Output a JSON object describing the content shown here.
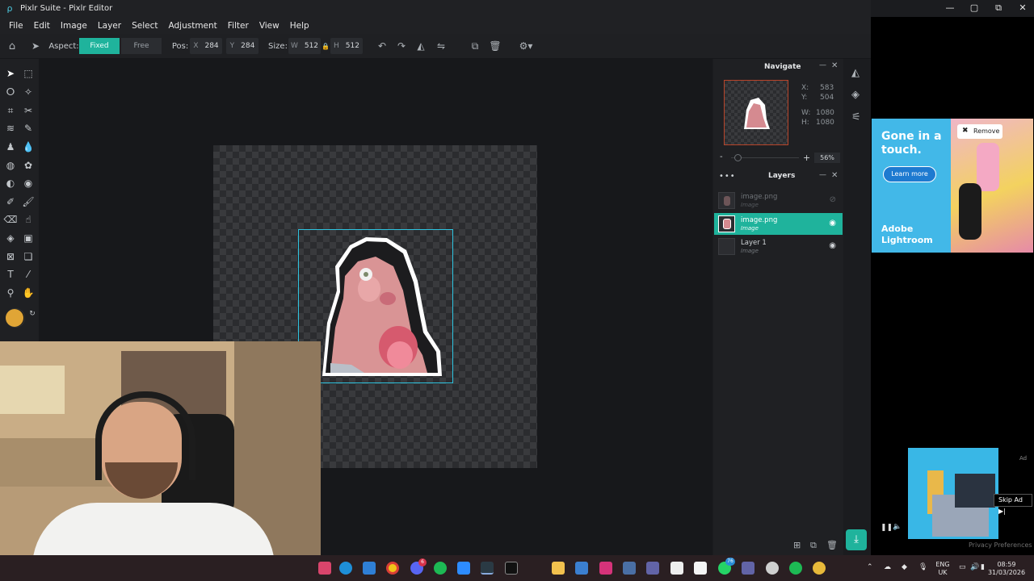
{
  "window": {
    "title": "Pixlr Suite - Pixlr Editor"
  },
  "menu": [
    "File",
    "Edit",
    "Image",
    "Layer",
    "Select",
    "Adjustment",
    "Filter",
    "View",
    "Help"
  ],
  "options": {
    "aspect_label": "Aspect:",
    "fixed": "Fixed",
    "free": "Free",
    "pos_label": "Pos:",
    "x_key": "X",
    "x_value": "284",
    "y_key": "Y",
    "y_value": "284",
    "size_label": "Size:",
    "w_key": "W",
    "w_value": "512",
    "h_key": "H",
    "h_value": "512"
  },
  "navigate": {
    "title": "Navigate",
    "x_label": "X:",
    "x_value": "583",
    "y_label": "Y:",
    "y_value": "504",
    "w_label": "W:",
    "w_value": "1080",
    "h_label": "H:",
    "h_value": "1080",
    "zoom_minus": "-",
    "zoom_plus": "+",
    "zoom": "56%",
    "zoom_fraction": 0.1
  },
  "layers": {
    "title": "Layers",
    "items": [
      {
        "name": "image.png",
        "type": "Image",
        "state": "hidden"
      },
      {
        "name": "image.png",
        "type": "Image",
        "state": "selected"
      },
      {
        "name": "Layer 1",
        "type": "Image",
        "state": "normal"
      }
    ]
  },
  "colors": {
    "accent": "#1fb39c",
    "selection": "#2ec4e0",
    "foreground": "#e0a536",
    "background": "#111111"
  },
  "ad": {
    "headline": "Gone in a touch.",
    "cta": "Learn more",
    "brand_line1": "Adobe",
    "brand_line2": "Lightroom",
    "remove": "Remove",
    "ad_label": "Ad",
    "skip": "Skip Ad",
    "privacy": "Privacy Preferences"
  },
  "taskbar": {
    "lang1": "ENG",
    "lang2": "UK",
    "time": "08:59",
    "date": "31/03/2026",
    "badge_discord": "6",
    "badge_whatsapp": "76"
  }
}
